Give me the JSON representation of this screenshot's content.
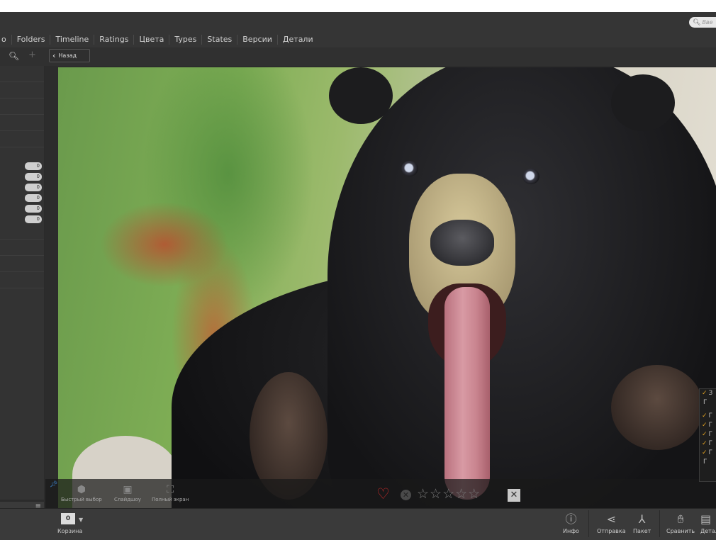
{
  "search": {
    "placeholder": "Вве"
  },
  "tabs": [
    {
      "label": "о"
    },
    {
      "label": "Folders"
    },
    {
      "label": "Timeline"
    },
    {
      "label": "Ratings"
    },
    {
      "label": "Цвета"
    },
    {
      "label": "Types"
    },
    {
      "label": "States"
    },
    {
      "label": "Версии"
    },
    {
      "label": "Детали"
    }
  ],
  "toolbar": {
    "back_label": "Назад"
  },
  "sidebar": {
    "counters": [
      "0",
      "0",
      "0",
      "0",
      "0",
      "0"
    ]
  },
  "viewer": {
    "bottom_items": [
      {
        "label": "Быстрый выбор",
        "icon": "quick-select-icon"
      },
      {
        "label": "Слайдшоу",
        "icon": "slideshow-icon"
      },
      {
        "label": "Полный экран",
        "icon": "fullscreen-icon"
      }
    ],
    "rating": {
      "stars_filled": 0,
      "stars_total": 5
    },
    "colors": {
      "heart": "#d02b2b",
      "check": "#e0a020"
    }
  },
  "right_panel": {
    "rows": [
      {
        "check": "✓",
        "text": "З"
      },
      {
        "check": "",
        "text": "Г"
      },
      {
        "check": "✓",
        "text": "Г"
      },
      {
        "check": "✓",
        "text": "Г"
      },
      {
        "check": "✓",
        "text": "Г"
      },
      {
        "check": "✓",
        "text": "Г"
      },
      {
        "check": "✓",
        "text": "Г"
      },
      {
        "check": "",
        "text": "Г"
      }
    ]
  },
  "statusbar": {
    "basket_count": "0",
    "basket_label": "Корзина",
    "actions": [
      {
        "label": "Инфо",
        "icon": "info-icon"
      },
      {
        "label": "Отправка",
        "icon": "share-icon"
      },
      {
        "label": "Пакет",
        "icon": "batch-icon"
      },
      {
        "label": "Сравнить",
        "icon": "compare-icon"
      },
      {
        "label": "Детали",
        "icon": "details-icon"
      }
    ]
  }
}
